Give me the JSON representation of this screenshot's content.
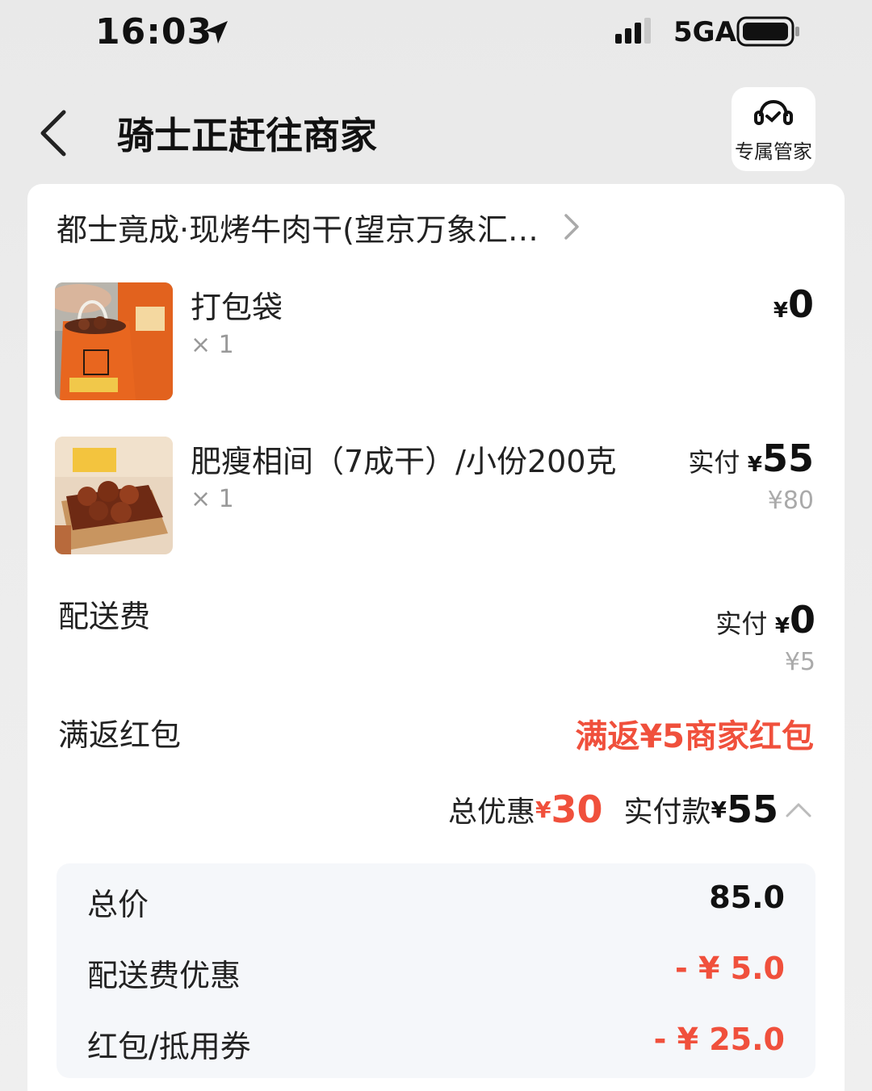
{
  "status_bar": {
    "time": "16:03",
    "network": "5GA",
    "icons": [
      "location-arrow-icon",
      "signal-icon",
      "battery-icon"
    ]
  },
  "header": {
    "title": "骑士正赶往商家",
    "service_label": "专属管家",
    "icons": [
      "back-chevron-icon",
      "headset-icon"
    ]
  },
  "shop": {
    "name": "都士竟成·现烤牛肉干(望京万象汇…",
    "icon": "chevron-right-icon"
  },
  "items": [
    {
      "name": "打包袋",
      "qty": "× 1",
      "yen": "¥",
      "price": "0",
      "paid_label": "",
      "original": ""
    },
    {
      "name": "肥瘦相间（7成干）/小份200克",
      "qty": "× 1",
      "yen": "¥",
      "price": "55",
      "paid_label": "实付",
      "original": "¥80"
    }
  ],
  "delivery": {
    "label": "配送费",
    "paid_label": "实付",
    "yen": "¥",
    "price": "0",
    "original": "¥5"
  },
  "promo": {
    "label": "满返红包",
    "value": "满返¥5商家红包"
  },
  "summary": {
    "discount_label": "总优惠",
    "discount_yen": "¥",
    "discount_amount": "30",
    "paid_label": "实付款",
    "paid_yen": "¥",
    "paid_amount": "55",
    "icon": "chevron-up-icon"
  },
  "breakdown": [
    {
      "label": "总价",
      "value": "85.0"
    },
    {
      "label": "配送费优惠",
      "value": "- ¥ 5.0"
    },
    {
      "label": "红包/抵用券",
      "value": "- ¥ 25.0"
    }
  ],
  "colors": {
    "accent_red": "#f0503c",
    "card_bg": "#ffffff",
    "breakdown_bg": "#f5f7fa"
  }
}
